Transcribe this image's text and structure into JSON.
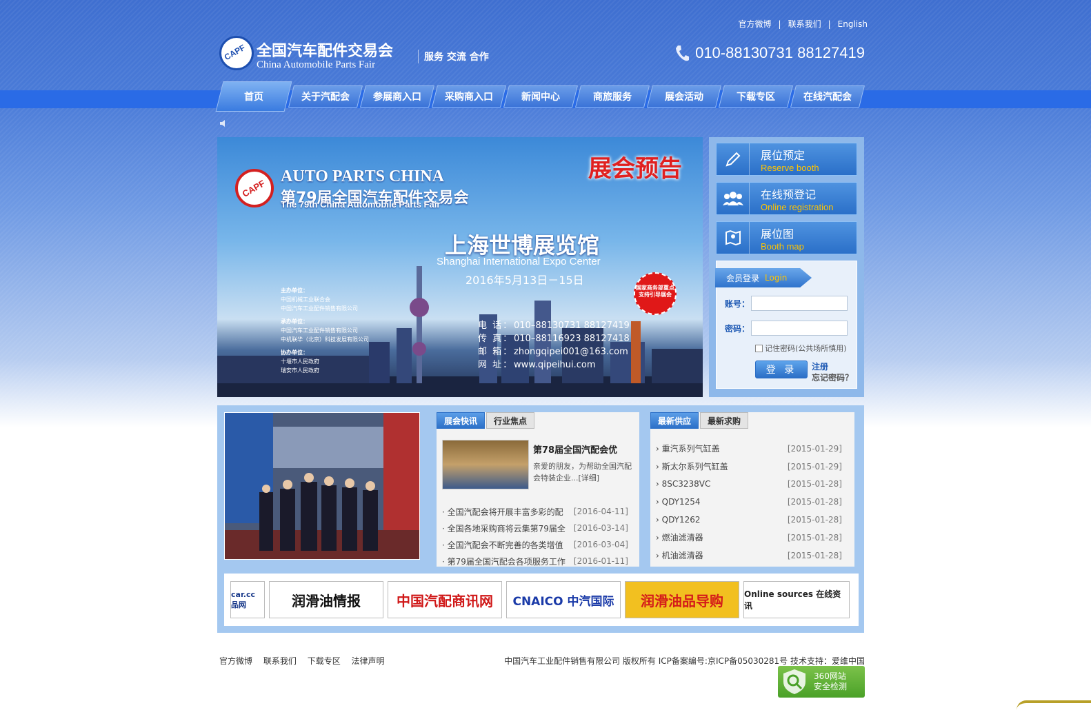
{
  "top_links": [
    "官方微博",
    "联系我们",
    "English"
  ],
  "logo": {
    "cn": "全国汽车配件交易会",
    "en": "China Automobile Parts Fair",
    "slogan": "服务 交流 合作"
  },
  "phone": "010-88130731 88127419",
  "nav": [
    "首页",
    "关于汽配会",
    "参展商入口",
    "采购商入口",
    "新闻中心",
    "商旅服务",
    "展会活动",
    "下载专区",
    "在线汽配会"
  ],
  "banner": {
    "announce": "展会预告",
    "title_en": "AUTO PARTS CHINA",
    "title_cn": "第79届全国汽车配件交易会",
    "title_en2": "The 79th China Automobile Parts Fair",
    "venue_cn": "上海世博展览馆",
    "venue_en": "Shanghai International Expo Center",
    "date": "2016年5月13日－15日",
    "organizers": [
      {
        "head": "主办单位：",
        "lines": [
          "中国机械工业联合会",
          "中国汽车工业配件销售有限公司"
        ]
      },
      {
        "head": "承办单位：",
        "lines": [
          "中国汽车工业配件销售有限公司",
          "中机联华（北京）科技发展有限公司"
        ]
      },
      {
        "head": "协办单位：",
        "lines": [
          "十堰市人民政府",
          "瑞安市人民政府"
        ]
      }
    ],
    "contact": [
      {
        "label": "电 话：",
        "value": "010–88130731  88127419"
      },
      {
        "label": "传 真：",
        "value": "010–88116923  88127418"
      },
      {
        "label": "邮 箱：",
        "value": "zhongqipei001@163.com"
      },
      {
        "label": "网 址：",
        "value": "www.qipeihui.com"
      }
    ],
    "badge": "国家商务部重点支持引导展会"
  },
  "services": [
    {
      "cn": "展位预定",
      "en": "Reserve booth",
      "icon": "pen-icon"
    },
    {
      "cn": "在线预登记",
      "en": "Online registration",
      "icon": "users-icon"
    },
    {
      "cn": "展位图",
      "en": "Booth map",
      "icon": "map-icon"
    }
  ],
  "login": {
    "tab_cn": "会员登录",
    "tab_en": "Login",
    "account_label": "账号：",
    "password_label": "密码：",
    "remember": "记住密码(公共场所慎用)",
    "button": "登 录",
    "register": "注册",
    "forgot": "忘记密码？"
  },
  "news": {
    "tabs": [
      "展会快讯",
      "行业焦点"
    ],
    "feature_title": "第78届全国汽配会优",
    "feature_desc": "亲爱的朋友，为帮助全国汽配会特装企业...[详细]",
    "items": [
      {
        "title": "全国汽配会将开展丰富多彩的配",
        "date": "[2016-04-11]"
      },
      {
        "title": "全国各地采购商将云集第79届全",
        "date": "[2016-03-14]"
      },
      {
        "title": "全国汽配会不断完善的各类增值",
        "date": "[2016-03-04]"
      },
      {
        "title": "第79届全国汽配会各项服务工作",
        "date": "[2016-01-11]"
      }
    ]
  },
  "supply": {
    "tabs": [
      "最新供应",
      "最新求购"
    ],
    "items": [
      {
        "title": "重汽系列气缸盖",
        "date": "[2015-01-29]"
      },
      {
        "title": "斯太尔系列气缸盖",
        "date": "[2015-01-29]"
      },
      {
        "title": "8SC3238VC",
        "date": "[2015-01-28]"
      },
      {
        "title": "QDY1254",
        "date": "[2015-01-28]"
      },
      {
        "title": "QDY1262",
        "date": "[2015-01-28]"
      },
      {
        "title": "燃油滤清器",
        "date": "[2015-01-28]"
      },
      {
        "title": "机油滤清器",
        "date": "[2015-01-28]"
      }
    ]
  },
  "partners": [
    {
      "text": "car.cc 品网",
      "color": "#1a3a8a"
    },
    {
      "text": "润滑油情报",
      "color": "#111111"
    },
    {
      "text": "中国汽配商讯网",
      "color": "#d01818"
    },
    {
      "text": "CNAICO 中汽国际",
      "color": "#1a3aa8"
    },
    {
      "text": "润滑油品导购",
      "color": "#d41a1a"
    },
    {
      "text": "Online sources 在线资讯",
      "color": "#222222"
    }
  ],
  "footer": {
    "links": [
      "官方微博",
      "联系我们",
      "下载专区",
      "法律声明"
    ],
    "copyright": "中国汽车工业配件销售有限公司 版权所有 ICP备案编号:京ICP备05030281号 技术支持：爱维中国",
    "security": [
      "360网站",
      "安全检测"
    ]
  }
}
